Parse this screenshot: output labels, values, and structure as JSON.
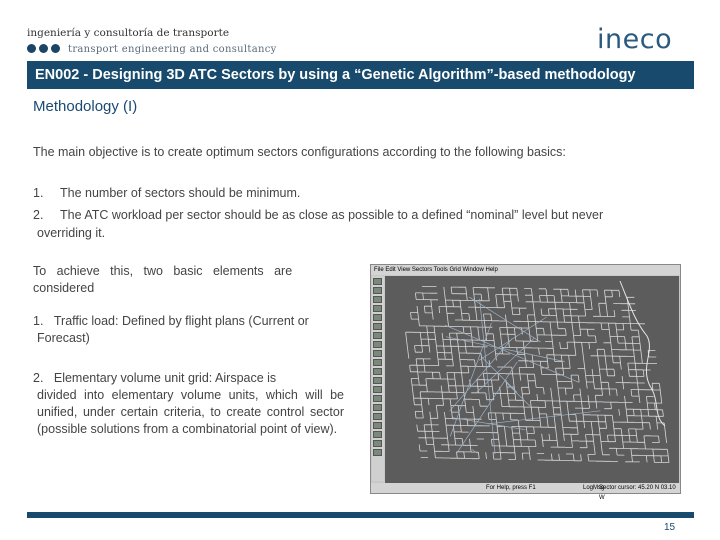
{
  "header": {
    "tagline_es": "ingeniería y consultoría de transporte",
    "tagline_en": "transport engineering and consultancy",
    "logo": "ineco"
  },
  "title": "EN002 - Designing 3D ATC Sectors by using a “Genetic Algorithm”-based methodology",
  "subtitle": "Methodology (I)",
  "main_objective": "The main objective is to create optimum sectors configurations according to the following basics:",
  "basics": [
    {
      "num": "1.",
      "text": "The number of sectors should be minimum."
    },
    {
      "num": "2.",
      "text": "The ATC workload per sector should be as close as possible to a defined “nominal” level but never",
      "cont": "overriding it."
    }
  ],
  "elements_intro_1": "To   achieve   this,   two   basic   elements   are",
  "elements_intro_2": "considered",
  "elements": [
    {
      "num": "1.",
      "text": "Traffic load: Defined by flight plans (Current or",
      "cont": "Forecast)"
    },
    {
      "num": "2.",
      "text": "Elementary volume unit grid: Airspace is",
      "cont": "divided into elementary volume units, which will be unified, under certain criteria, to create control sector (possible solutions from a combinatorial point of view)."
    }
  ],
  "screenshot": {
    "menu": "File  Edit  View  Sectors  Tools  Grid  Window  Help",
    "status_left": "For Help, press F1",
    "status_mid": "LogMsg",
    "status_right": "Sector cursor: 45.20 N  03.10 W"
  },
  "footer": {
    "page": "15"
  },
  "colors": {
    "brand": "#174a6c",
    "subtitle": "#1a4a73"
  }
}
